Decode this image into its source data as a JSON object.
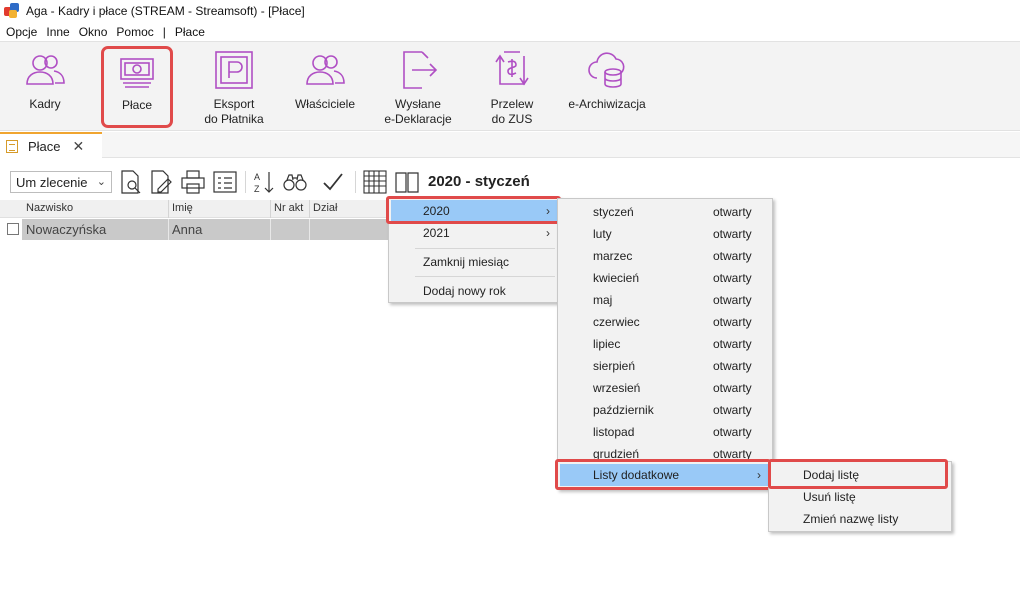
{
  "window": {
    "title": "Aga - Kadry i płace (STREAM - Streamsoft) - [Płace]"
  },
  "menubar": [
    "Opcje",
    "Inne",
    "Okno",
    "Pomoc",
    "|",
    "Płace"
  ],
  "ribbon": {
    "items": [
      {
        "id": "kadry",
        "label": "Kadry",
        "icon": "people-icon"
      },
      {
        "id": "place",
        "label": "Płace",
        "icon": "money-icon",
        "selected": true
      },
      {
        "id": "eksport",
        "label": "Eksport\ndo Płatnika",
        "icon": "platnik-icon"
      },
      {
        "id": "wlasciciele",
        "label": "Właściciele",
        "icon": "owners-icon"
      },
      {
        "id": "wyslane",
        "label": "Wysłane\ne-Deklaracje",
        "icon": "send-icon"
      },
      {
        "id": "przelew",
        "label": "Przelew\ndo ZUS",
        "icon": "transfer-icon"
      },
      {
        "id": "earchiwizacja",
        "label": "e-Archiwizacja",
        "icon": "cloud-database-icon"
      }
    ],
    "accent_color": "#b04fc4"
  },
  "doc_tab": {
    "label": "Płace",
    "close": "✕"
  },
  "toolbar": {
    "contract_type": "Um zlecenie",
    "period": "2020 - styczeń"
  },
  "grid": {
    "columns": [
      "Nazwisko",
      "Imię",
      "Nr akt",
      "Dział"
    ],
    "rows": [
      {
        "nazwisko": "Nowaczyńska",
        "imie": "Anna",
        "nr_akt": "",
        "dzial": ""
      }
    ]
  },
  "menu_years": {
    "items": [
      {
        "label": "2020",
        "has_submenu": true,
        "highlighted": true
      },
      {
        "label": "2021",
        "has_submenu": true
      },
      {
        "label": "Zamknij miesiąc"
      },
      {
        "label": "Dodaj nowy rok"
      }
    ]
  },
  "menu_months": {
    "items": [
      {
        "label": "styczeń",
        "state": "otwarty"
      },
      {
        "label": "luty",
        "state": "otwarty"
      },
      {
        "label": "marzec",
        "state": "otwarty"
      },
      {
        "label": "kwiecień",
        "state": "otwarty"
      },
      {
        "label": "maj",
        "state": "otwarty"
      },
      {
        "label": "czerwiec",
        "state": "otwarty"
      },
      {
        "label": "lipiec",
        "state": "otwarty"
      },
      {
        "label": "sierpień",
        "state": "otwarty"
      },
      {
        "label": "wrzesień",
        "state": "otwarty"
      },
      {
        "label": "październik",
        "state": "otwarty"
      },
      {
        "label": "listopad",
        "state": "otwarty"
      },
      {
        "label": "grudzień",
        "state": "otwarty"
      }
    ],
    "extra": {
      "label": "Listy dodatkowe",
      "has_submenu": true,
      "highlighted": true
    }
  },
  "menu_lists": {
    "items": [
      {
        "label": "Dodaj listę",
        "highlighted": true
      },
      {
        "label": "Usuń listę"
      },
      {
        "label": "Zmień nazwę listy"
      }
    ]
  },
  "colors": {
    "highlight": "#99c9f7",
    "callout": "#e04a4a"
  }
}
